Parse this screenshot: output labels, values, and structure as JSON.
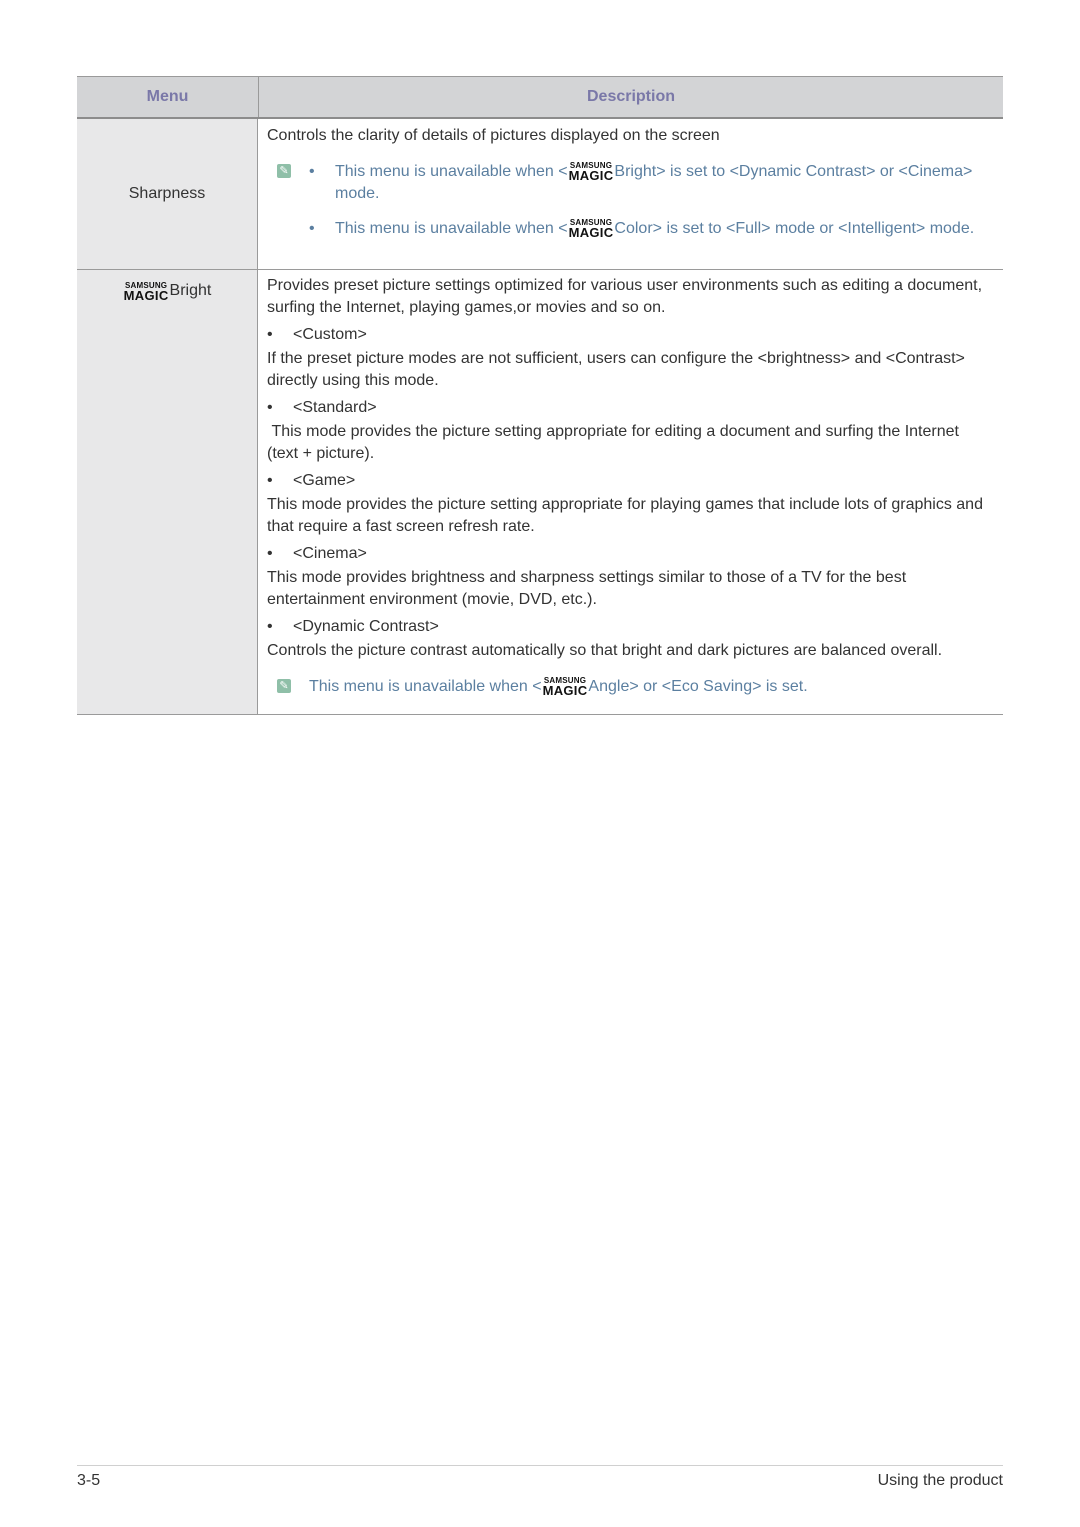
{
  "table": {
    "headers": {
      "menu": "Menu",
      "description": "Description"
    },
    "rows": [
      {
        "menu": "Sharpness",
        "description": "Controls the clarity of details of pictures displayed on the screen",
        "notes": [
          {
            "prefix": "This menu is unavailable when <",
            "logo": "SAMSUNG MAGIC",
            "suffix_line1": "Bright> is set to <Dynamic Contrast> or <Cinema>",
            "suffix_line2": "mode."
          },
          {
            "prefix": "This menu is unavailable when <",
            "logo": "SAMSUNG MAGIC",
            "suffix_line1": "Color> is set to <Full> mode or <Intelligent> mode."
          }
        ]
      },
      {
        "menu_logo_top": "SAMSUNG",
        "menu_logo_bottom": "MAGIC",
        "menu": "Bright",
        "intro": "Provides preset picture settings optimized for various user environments such as editing a document, surfing the Internet, playing games,or movies and so on.",
        "modes": [
          {
            "name": "<Custom>",
            "text": "If the preset picture modes are not sufficient, users can configure the <brightness> and <Contrast> directly using this mode."
          },
          {
            "name": "<Standard>",
            "text": " This mode provides the picture setting appropriate for editing a document and surfing the Internet (text + picture)."
          },
          {
            "name": "<Game>",
            "text": "This mode provides the picture setting appropriate for playing games that include lots of graphics and that require a fast screen refresh rate."
          },
          {
            "name": "<Cinema>",
            "text": "This mode provides brightness and sharpness settings similar to those of a TV for the best entertainment environment (movie, DVD, etc.)."
          },
          {
            "name": "<Dynamic Contrast>",
            "text": "Controls the picture contrast automatically so that bright and dark pictures are balanced overall."
          }
        ],
        "note": {
          "prefix": "This menu is unavailable when <",
          "suffix": "Angle> or <Eco Saving> is set."
        }
      }
    ]
  },
  "logo": {
    "top": "SAMSUNG",
    "bottom": "MAGIC"
  },
  "bullet": "•",
  "note_icon": "✎",
  "footer": {
    "page": "3-5",
    "section": "Using the product"
  },
  "colors": {
    "header_text": "#7a78a8",
    "note_text": "#5b7fa0",
    "menu_bg": "#e8e8e9",
    "header_bg": "#d3d4d6"
  }
}
